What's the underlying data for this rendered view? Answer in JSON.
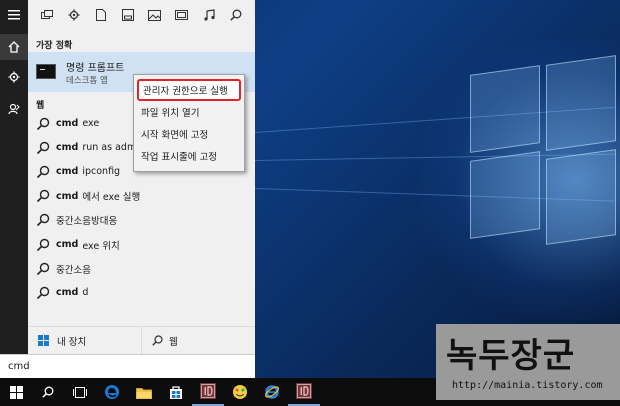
{
  "toolbar": {
    "icons": [
      "apps-icon",
      "settings-icon",
      "documents-icon",
      "folders-icon",
      "photos-icon",
      "videos-icon",
      "music-icon",
      "search-icon"
    ]
  },
  "best_match": {
    "heading": "가장 정확",
    "app_name": "명령 프롬프트",
    "app_type": "데스크톱 앱"
  },
  "web_section": {
    "heading": "웹"
  },
  "results": [
    {
      "bold": "cmd",
      "rest": "exe"
    },
    {
      "bold": "cmd",
      "rest": "run as admi"
    },
    {
      "bold": "cmd",
      "rest": "ipconfig"
    },
    {
      "bold": "cmd",
      "rest": "에서 exe 실행"
    },
    {
      "bold": "",
      "rest": "중간소음방대응"
    },
    {
      "bold": "cmd",
      "rest": "exe 위치"
    },
    {
      "bold": "",
      "rest": "중간소음"
    },
    {
      "bold": "cmd",
      "rest": "d"
    }
  ],
  "context_menu": [
    "관리자 권한으로 실행",
    "파일 위치 열기",
    "시작 화면에 고정",
    "작업 표시줄에 고정"
  ],
  "filters": {
    "my_stuff": "내 장치",
    "web": "웹"
  },
  "search": {
    "value": "cmd"
  },
  "watermark": {
    "title": "녹두장군",
    "url": "http://mainia.tistory.com"
  },
  "colors": {
    "highlight_border": "#e0242a",
    "selected_row": "#cfe1f2",
    "rail": "#1f1f1f",
    "taskbar": "#0c0c0c"
  }
}
